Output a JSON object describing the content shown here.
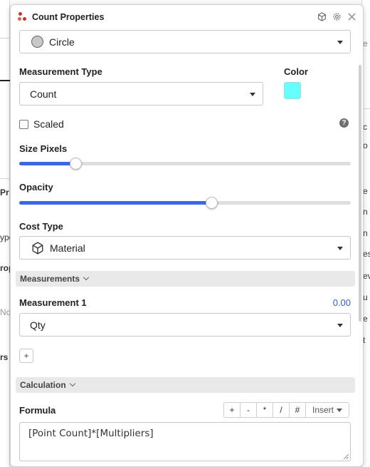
{
  "background": {
    "left_fragments": [
      "Pr",
      "ype",
      "rop",
      "No",
      "rs"
    ],
    "right_fragments": [
      "e",
      "c",
      "o",
      "e",
      "n",
      "n",
      "es",
      "ev",
      "u",
      "e",
      "t"
    ]
  },
  "panel": {
    "title": "Count Properties",
    "shape_dropdown": {
      "icon": "circle-icon",
      "value": "Circle"
    },
    "measurement_type": {
      "label": "Measurement Type",
      "value": "Count"
    },
    "color": {
      "label": "Color",
      "value": "#66ffff"
    },
    "scaled": {
      "label": "Scaled",
      "checked": false
    },
    "size_pixels": {
      "label": "Size Pixels",
      "fraction": 0.17
    },
    "opacity": {
      "label": "Opacity",
      "fraction": 0.58
    },
    "cost_type": {
      "label": "Cost Type",
      "icon": "cube-icon",
      "value": "Material"
    },
    "measurements_section": {
      "label": "Measurements"
    },
    "measurement_1": {
      "label": "Measurement 1",
      "value": "0.00",
      "unit": "Qty"
    },
    "add_button": "+",
    "calculation_section": {
      "label": "Calculation"
    },
    "formula": {
      "label": "Formula",
      "ops": [
        "+",
        "-",
        "*",
        "/",
        "#"
      ],
      "insert_label": "Insert",
      "value": "[Point Count]*[Multipliers]"
    }
  },
  "colors": {
    "accent": "#3a66e8",
    "link": "#2f5fd0",
    "swatch": "#66ffff"
  }
}
